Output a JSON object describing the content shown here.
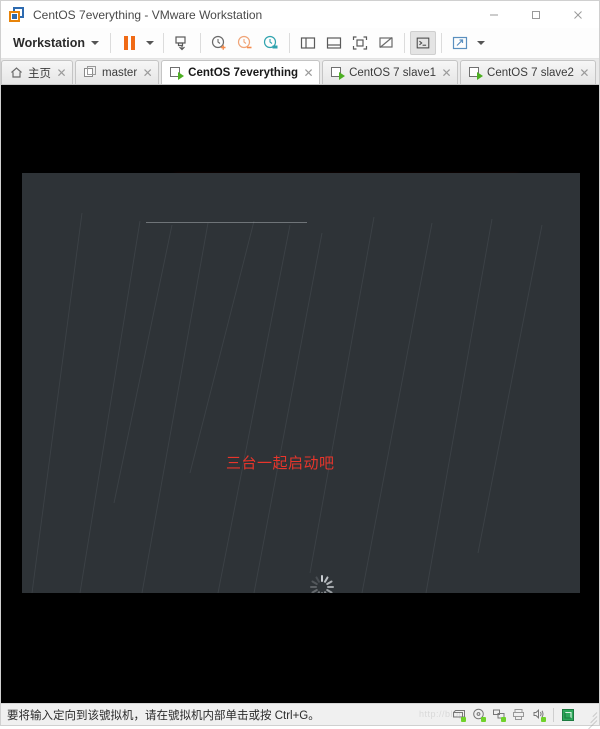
{
  "window": {
    "title": "CentOS 7everything - VMware Workstation",
    "app_icon": "vmware-logo-icon",
    "controls": {
      "minimize": "−",
      "maximize": "□",
      "close": "×"
    }
  },
  "toolbar": {
    "menu_label": "Workstation",
    "menu_caret": "▾",
    "buttons": [
      {
        "name": "suspend-button",
        "icon": "pause-icon",
        "interactable": true
      },
      {
        "name": "power-dropdown-button",
        "icon": "chevron-down-icon",
        "interactable": true
      },
      {
        "name": "manage-snapshots-button",
        "icon": "snapshot-manager-icon",
        "interactable": true
      },
      {
        "name": "take-snapshot-button",
        "icon": "snapshot-take-icon",
        "interactable": true
      },
      {
        "name": "revert-snapshot-button",
        "icon": "snapshot-revert-icon",
        "interactable": true
      },
      {
        "name": "snapshot-manager-button",
        "icon": "snapshot-list-icon",
        "interactable": true
      },
      {
        "name": "show-library-button",
        "icon": "library-panel-icon",
        "interactable": true
      },
      {
        "name": "show-thumbnails-button",
        "icon": "thumbnail-bar-icon",
        "interactable": true
      },
      {
        "name": "fullscreen-button",
        "icon": "fullscreen-icon",
        "interactable": true
      },
      {
        "name": "unity-mode-button",
        "icon": "unity-mode-icon",
        "interactable": true
      },
      {
        "name": "console-view-button",
        "icon": "console-icon",
        "interactable": true
      },
      {
        "name": "stretch-guest-button",
        "icon": "stretch-arrows-icon",
        "interactable": true
      },
      {
        "name": "stretch-dropdown-button",
        "icon": "chevron-down-icon",
        "interactable": true
      }
    ]
  },
  "tabs": [
    {
      "label": "主页",
      "icon": "home-icon",
      "active": false,
      "closable": true
    },
    {
      "label": "master",
      "icon": "vm-folder-icon",
      "active": false,
      "closable": true
    },
    {
      "label": "CentOS 7everything",
      "icon": "vm-running-icon",
      "active": true,
      "closable": true
    },
    {
      "label": "CentOS 7  slave1",
      "icon": "vm-running-icon",
      "active": false,
      "closable": true
    },
    {
      "label": "CentOS 7 slave2",
      "icon": "vm-running-icon",
      "active": false,
      "closable": true
    }
  ],
  "vm_view": {
    "annotation_text": "三台一起启动吧",
    "annotation_color": "#e8352b",
    "annotation_line_color": "#f9392f",
    "screen_background": "#2e3337",
    "outer_background": "#000000",
    "spinner_label": "loading-spinner"
  },
  "statusbar": {
    "message": "要将输入定向到该號拟机，请在號拟机内部单击或按 Ctrl+G。",
    "watermark": "http://blog.",
    "devices": [
      {
        "name": "status-hard-disk",
        "icon": "hard-disk-icon",
        "active": true
      },
      {
        "name": "status-cd-dvd",
        "icon": "cd-dvd-icon",
        "active": true
      },
      {
        "name": "status-network",
        "icon": "network-adapter-icon",
        "active": true
      },
      {
        "name": "status-printer",
        "icon": "printer-icon",
        "active": false
      },
      {
        "name": "status-sound",
        "icon": "sound-card-icon",
        "active": true
      },
      {
        "name": "status-shared-folders",
        "icon": "shared-folder-icon",
        "active": false
      }
    ],
    "resize_grip": "resize-grip-icon"
  }
}
